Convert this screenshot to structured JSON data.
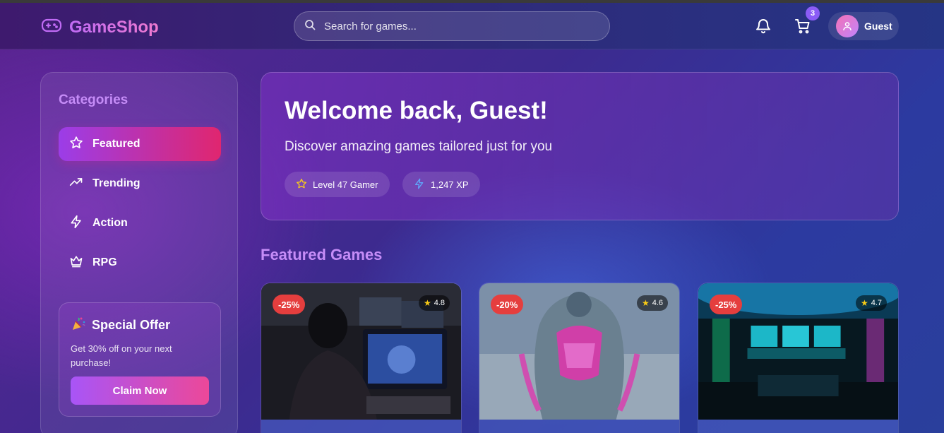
{
  "header": {
    "app_name": "GameShop",
    "search_placeholder": "Search for games...",
    "cart_count": "3",
    "user_name": "Guest"
  },
  "sidebar": {
    "title": "Categories",
    "items": [
      {
        "label": "Featured",
        "icon": "star-icon",
        "active": true
      },
      {
        "label": "Trending",
        "icon": "trending-up-icon",
        "active": false
      },
      {
        "label": "Action",
        "icon": "lightning-icon",
        "active": false
      },
      {
        "label": "RPG",
        "icon": "crown-icon",
        "active": false
      }
    ],
    "offer": {
      "title": "Special Offer",
      "text": "Get 30% off on your next purchase!",
      "button": "Claim Now"
    }
  },
  "welcome": {
    "title": "Welcome back, Guest!",
    "subtitle": "Discover amazing games tailored just for you",
    "level": "Level 47 Gamer",
    "xp": "1,247 XP"
  },
  "featured": {
    "title": "Featured Games",
    "games": [
      {
        "discount": "-25%",
        "rating": "4.8"
      },
      {
        "discount": "-20%",
        "rating": "4.6"
      },
      {
        "discount": "-25%",
        "rating": "4.7"
      }
    ]
  },
  "colors": {
    "accent_purple": "#c58cf7",
    "active_gradient_start": "#9b3de8",
    "active_gradient_end": "#e0266f",
    "discount_red": "#e53e3e",
    "rating_star": "#facc15"
  }
}
